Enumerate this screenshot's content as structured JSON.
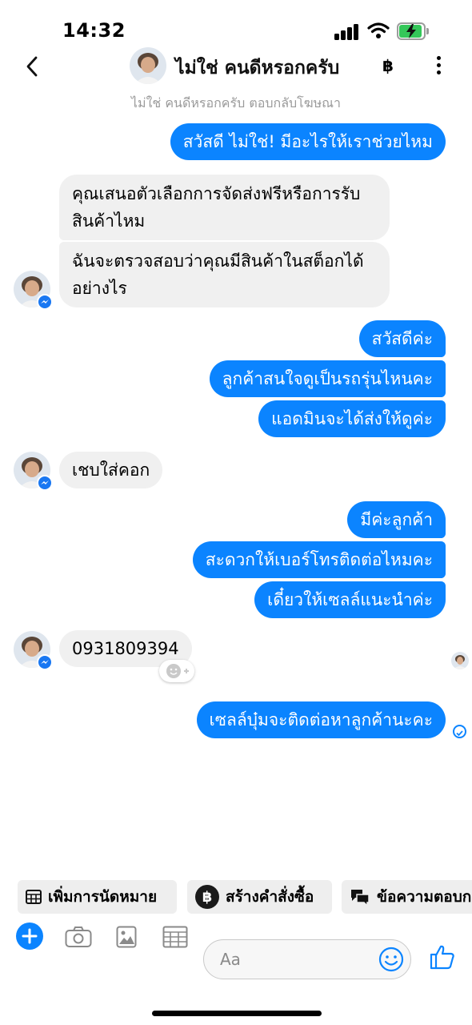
{
  "status_bar": {
    "time": "14:32"
  },
  "header": {
    "contact_name": "ไม่ใช่ คนดีหรอกครับ",
    "subtitle": "ไม่ใช่ คนดีหรอกครับ ตอบกลับโฆษณา"
  },
  "messages": {
    "m1": "สวัสดี ไม่ใช่! มีอะไรให้เราช่วยไหม",
    "m2_line1": "คุณเสนอตัวเลือกการจัดส่งฟรีหรือการรับ",
    "m2_line2": "สินค้าไหม",
    "m3_line1": "ฉันจะตรวจสอบว่าคุณมีสินค้าในสต็อกได้",
    "m3_line2": "อย่างไร",
    "m4": "สวัสดีค่ะ",
    "m5": "ลูกค้าสนใจดูเป็นรถรุ่นไหนคะ",
    "m6": "แอดมินจะได้ส่งให้ดูค่ะ",
    "m7": "เชบใส่คอก",
    "m8": "มีค่ะลูกค้า",
    "m9": "สะดวกให้เบอร์โทรติดต่อไหมคะ",
    "m10": "เดี๋ยวให้เซลล์แนะนำค่ะ",
    "m11": "0931809394",
    "m12": "เซลล์บุ๋มจะติดต่อหาลูกค้านะคะ"
  },
  "quick_actions": {
    "appointment": "เพิ่มการนัดหมาย",
    "order": "สร้างคำสั่งซื้อ",
    "saved_reply": "ข้อความตอบก"
  },
  "composer": {
    "placeholder": "Aa"
  },
  "colors": {
    "accent": "#0b84ff",
    "incoming_bubble": "#f0f0f0"
  }
}
